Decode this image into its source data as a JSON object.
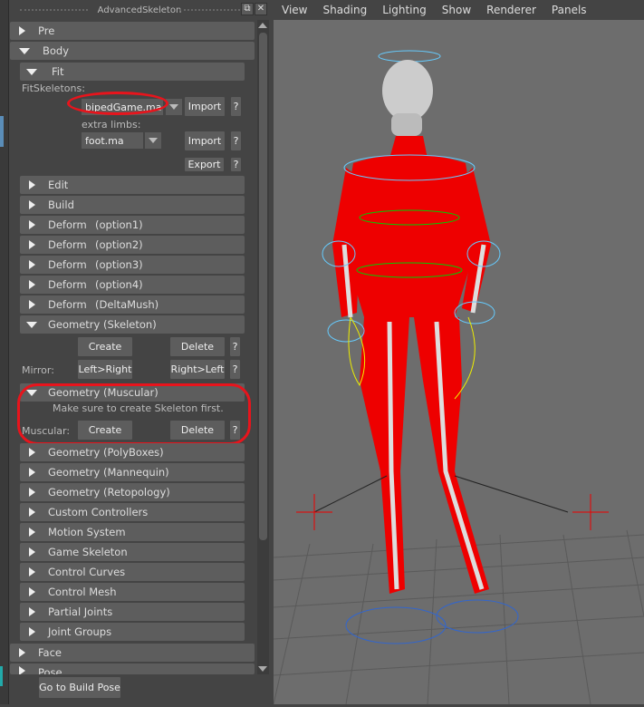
{
  "window": {
    "title": "AdvancedSkeleton",
    "float_icon": "float-window-icon",
    "close_icon": "close-icon"
  },
  "sections": {
    "pre": "Pre",
    "body": "Body",
    "face": "Face",
    "pose": "Pose"
  },
  "fit": {
    "label": "Fit",
    "fit_skeletons_label": "FitSkeletons:",
    "fit_skeleton_value": "bipedGame.ma",
    "import_label": "Import",
    "help_label": "?",
    "extra_limbs_label": "extra limbs:",
    "extra_limbs_value": "foot.ma",
    "import2_label": "Import",
    "export_label": "Export"
  },
  "body_items": [
    {
      "label": "Edit"
    },
    {
      "label": "Build"
    },
    {
      "label": "Deform",
      "opt": "(option1)"
    },
    {
      "label": "Deform",
      "opt": "(option2)"
    },
    {
      "label": "Deform",
      "opt": "(option3)"
    },
    {
      "label": "Deform",
      "opt": "(option4)"
    },
    {
      "label": "Deform",
      "opt": "(DeltaMush)"
    }
  ],
  "geometry_skeleton": {
    "label": "Geometry (Skeleton)",
    "create": "Create",
    "delete": "Delete",
    "mirror_label": "Mirror:",
    "left_right": "Left>Right",
    "right_left": "Right>Left",
    "help": "?"
  },
  "geometry_muscular": {
    "label": "Geometry (Muscular)",
    "note": "Make sure to create Skeleton first.",
    "muscular_label": "Muscular:",
    "create": "Create",
    "delete": "Delete",
    "help": "?"
  },
  "more_items": [
    "Geometry (PolyBoxes)",
    "Geometry (Mannequin)",
    "Geometry (Retopology)",
    "Custom Controllers",
    "Motion System",
    "Game Skeleton",
    "Control Curves",
    "Control Mesh",
    "Partial Joints",
    "Joint Groups"
  ],
  "bottom_button": "Go to Build Pose",
  "viewport": {
    "menu": [
      "View",
      "Shading",
      "Lighting",
      "Show",
      "Renderer",
      "Panels"
    ]
  },
  "colors": {
    "highlight": "#e8141c",
    "rig_red": "#e00000",
    "panel": "#444444"
  }
}
